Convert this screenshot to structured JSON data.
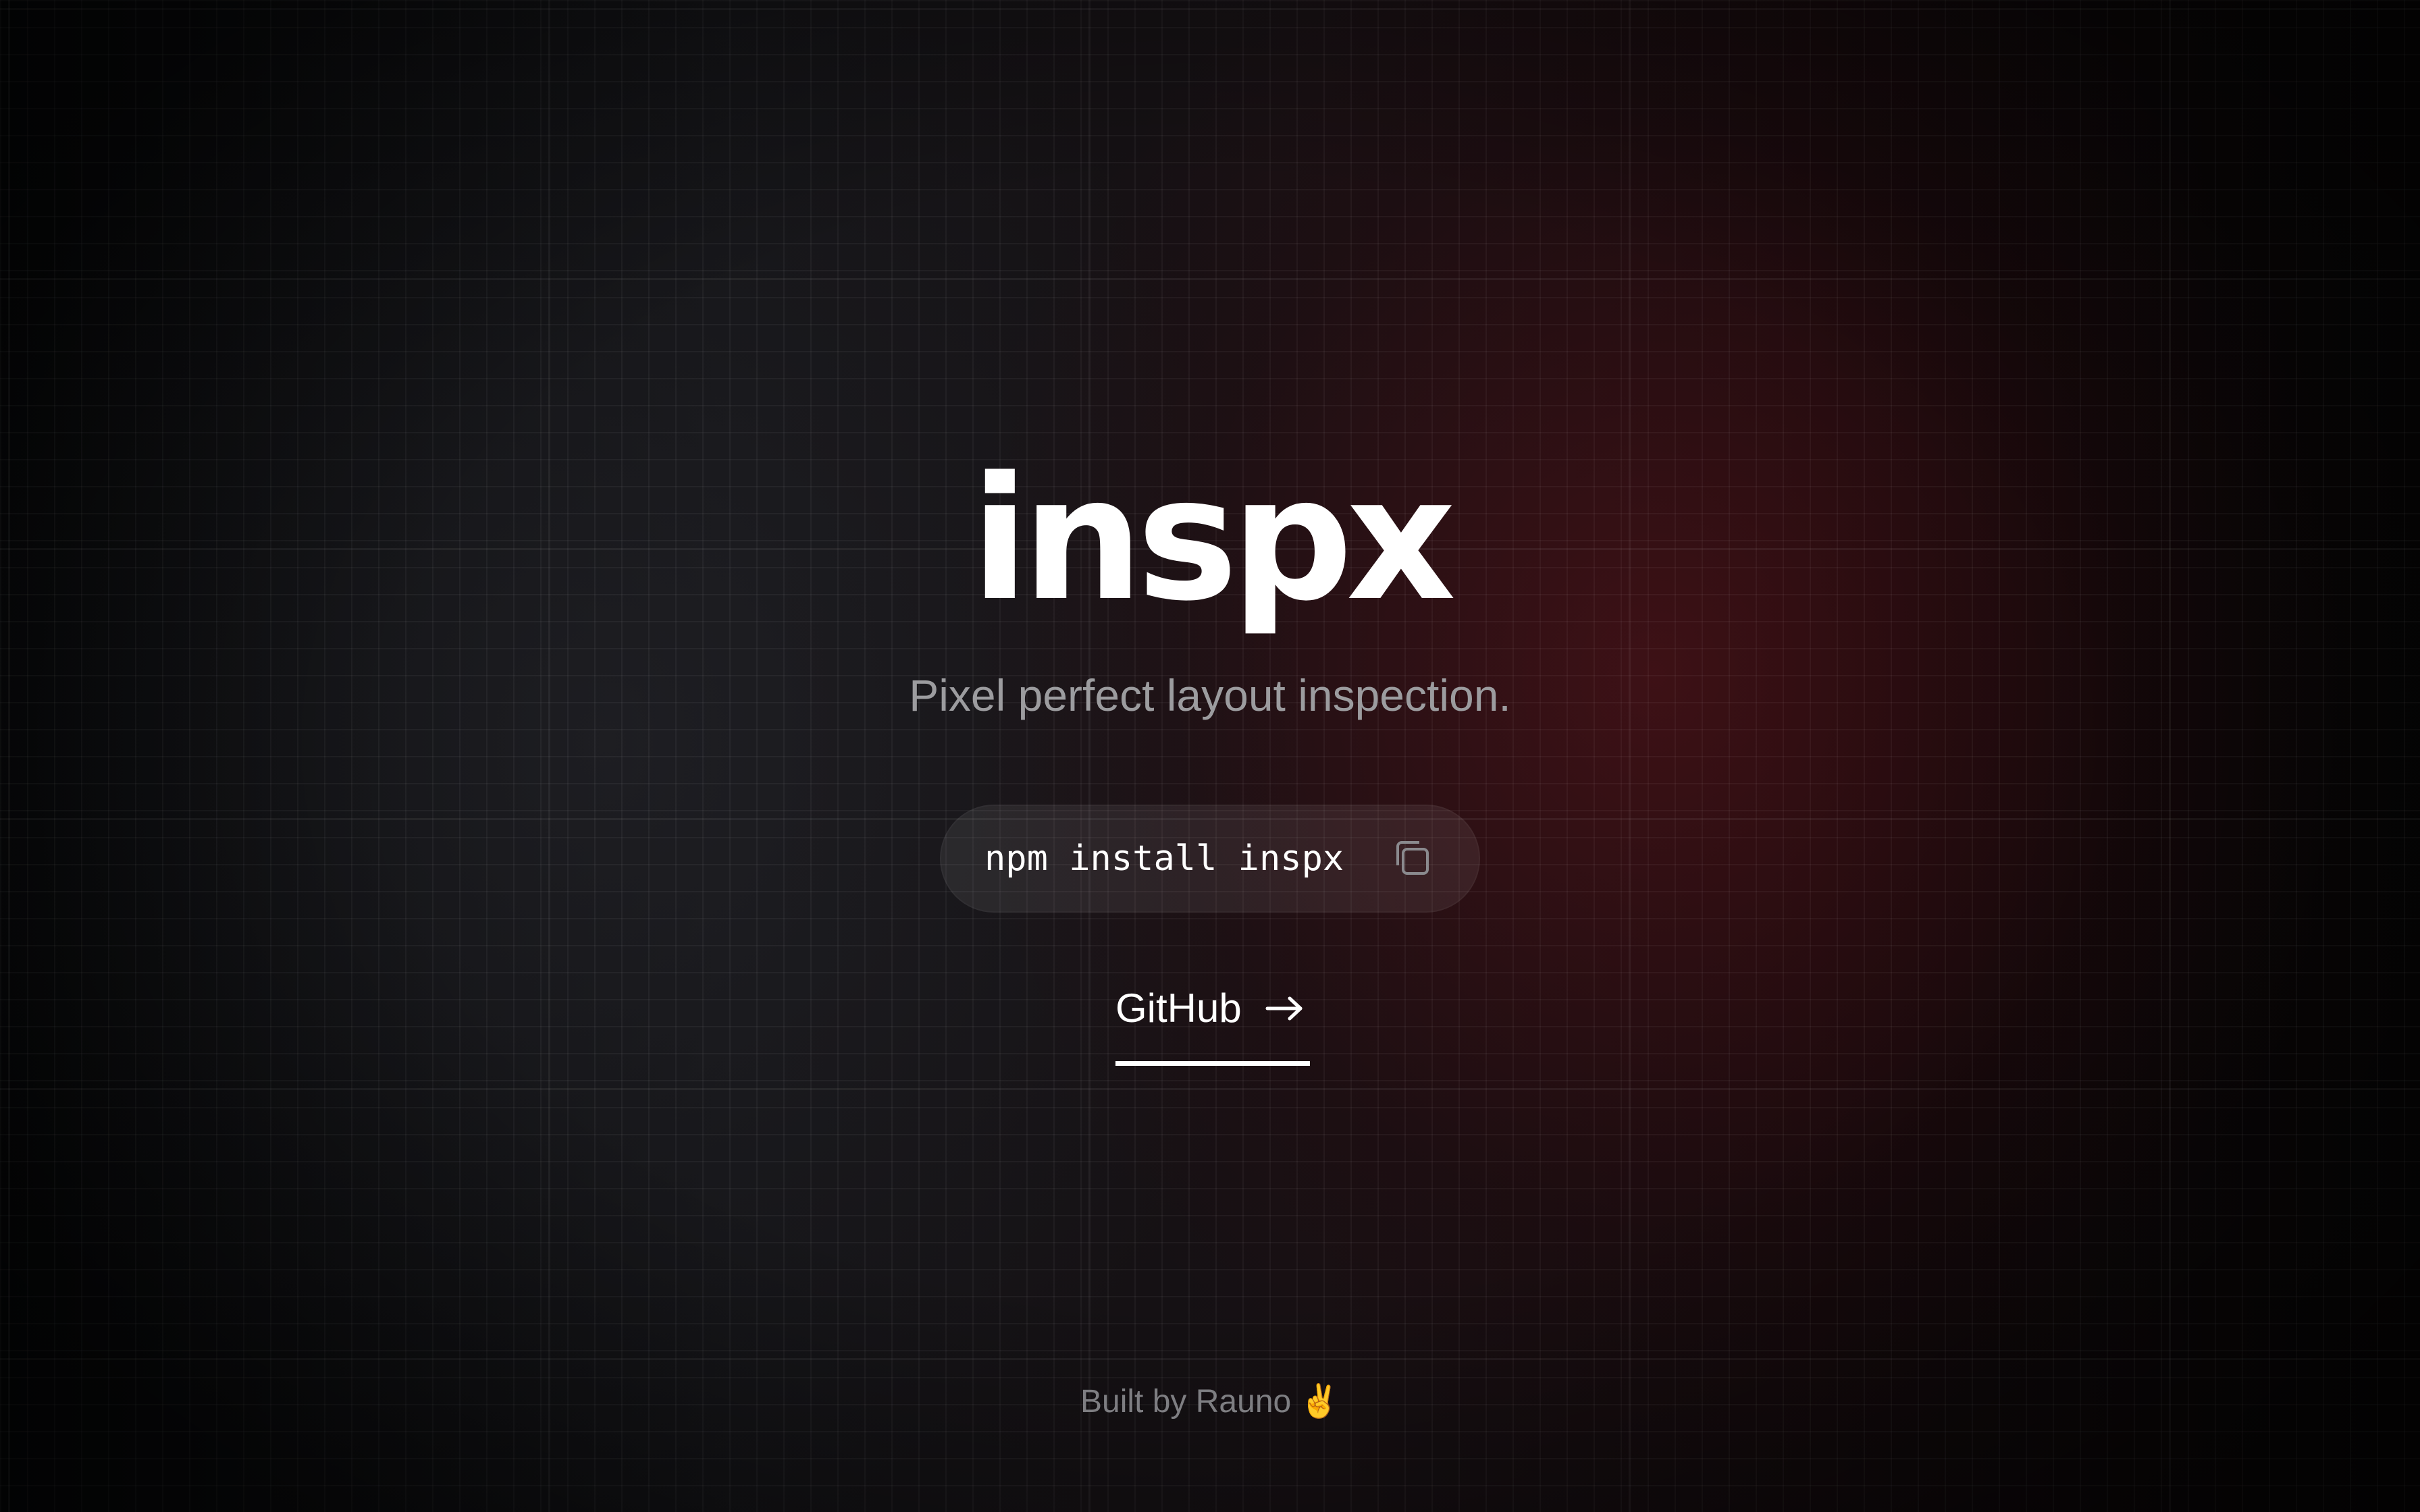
{
  "hero": {
    "title": "inspx",
    "subtitle": "Pixel perfect layout inspection."
  },
  "install": {
    "command": "npm install inspx",
    "copy_icon": "copy-icon"
  },
  "github": {
    "label": "GitHub",
    "arrow_icon": "arrow-right-icon"
  },
  "footer": {
    "text": "Built by Rauno",
    "emoji": "✌️"
  },
  "colors": {
    "background": "#0b0b0c",
    "accent_glow": "#78181f",
    "text_primary": "#ffffff",
    "text_muted": "#9c9c9f"
  }
}
